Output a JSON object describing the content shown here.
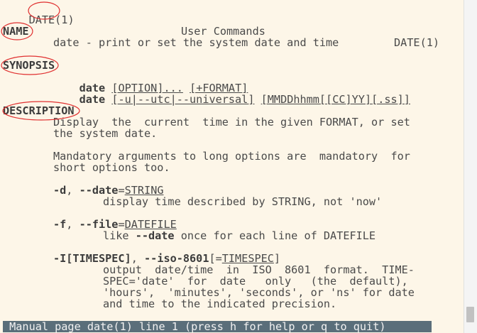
{
  "header": {
    "left": "DATE(1)",
    "center": "User Commands",
    "right": "DATE(1)"
  },
  "name": {
    "heading": "NAME",
    "text": "date - print or set the system date and time"
  },
  "synopsis": {
    "heading": "SYNOPSIS",
    "line1": {
      "cmd": "date",
      "opt1": "[OPTION]...",
      "opt2": "[+FORMAT]"
    },
    "line2": {
      "cmd": "date",
      "opt1": "[-u|--utc|--universal]",
      "opt2": "[MMDDhhmm[[CC]YY][.ss]]"
    }
  },
  "description": {
    "heading": "DESCRIPTION",
    "p1a": "Display  the  current  time in the given FORMAT, or set",
    "p1b": "the system date.",
    "p2a": "Mandatory arguments to long options are  mandatory  for",
    "p2b": "short options too.",
    "opt_d": {
      "flag": "-d",
      "sep": ", ",
      "long": "--date",
      "eq": "=",
      "arg": "STRING",
      "desc": "display time described by STRING, not 'now'"
    },
    "opt_f": {
      "flag": "-f",
      "sep": ", ",
      "long": "--file",
      "eq": "=",
      "arg": "DATEFILE",
      "desc_a": "like ",
      "desc_b": "--date",
      "desc_c": " once for each line of DATEFILE"
    },
    "opt_I": {
      "flag": "-I[TIMESPEC]",
      "sep": ", ",
      "long": "--iso-8601",
      "bracket_open": "[=",
      "arg": "TIMESPEC",
      "bracket_close": "]",
      "desc1": "output  date/time  in  ISO  8601  format.  TIME-",
      "desc2": "SPEC='date'  for  date   only   (the  default),",
      "desc3": "'hours',  'minutes', 'seconds', or 'ns' for date",
      "desc4": "and time to the indicated precision."
    }
  },
  "status_bar": " Manual page date(1) line 1 (press h for help or q to quit)",
  "colors": {
    "background": "#fdf6e8",
    "annotation": "#e03030",
    "status_bg": "#5a6e7a"
  }
}
